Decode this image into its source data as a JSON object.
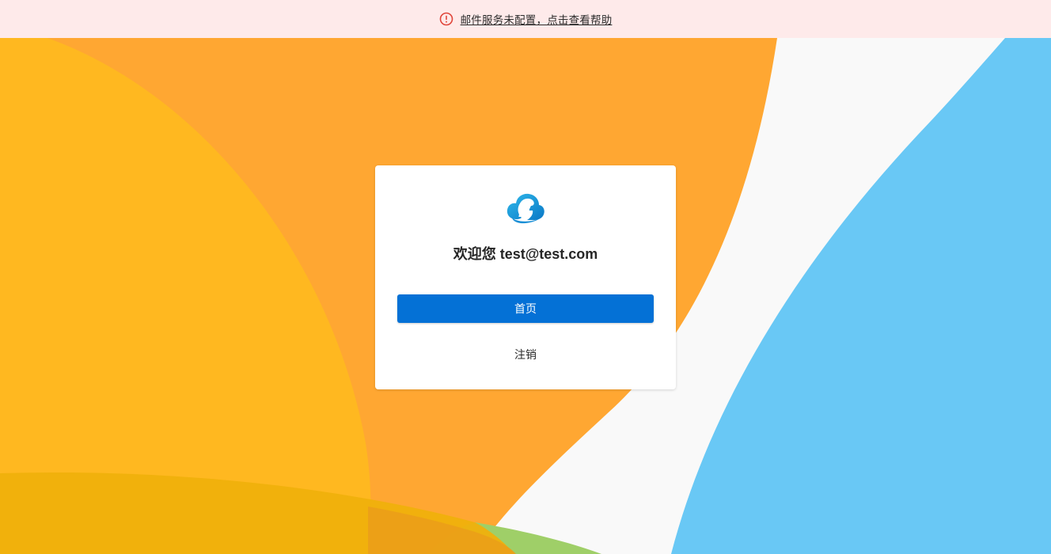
{
  "alert": {
    "icon": "alert-circle-icon",
    "message": "邮件服务未配置，点击查看帮助",
    "color": "#e0453a"
  },
  "card": {
    "logo_icon": "cloud-h-logo-icon",
    "welcome": "欢迎您 test@test.com",
    "home_button": "首页",
    "logout_link": "注销"
  },
  "colors": {
    "primary": "#0471d6",
    "alert_bg": "#feeaea",
    "bg_yellow": "#ffb820",
    "bg_orange": "#ffa732",
    "bg_blue": "#69c8f5",
    "bg_green": "#9fcf68"
  }
}
